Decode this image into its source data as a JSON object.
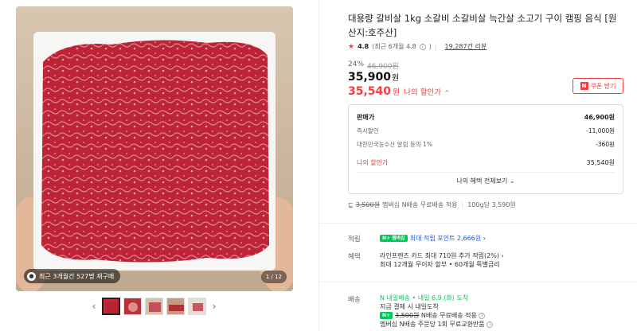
{
  "product": {
    "title": "대용량 갈비살 1kg 소갈비 소갈비살 늑간살 소고기 구이 캠핑 음식 [원산지:호주산]",
    "rating": "4.8",
    "rating_detail": "(최근 6개월 4.8",
    "reviews": "19,287건 리뷰",
    "discount_pct": "24%",
    "original_price": "46,900원",
    "price": "35,900",
    "price_unit": "원",
    "my_price": "35,540",
    "my_price_unit": "원",
    "my_price_label": "나의 할인가",
    "coupon_label": "쿠폰 받기"
  },
  "gallery": {
    "review_badge": "최근 3개월간 527명 재구매",
    "counter": "1 / 12"
  },
  "price_box": {
    "sale_label": "판매가",
    "sale_value": "46,900원",
    "instant_label": "즉시할인",
    "instant_value": "-11,000원",
    "agri_label": "대한민국농수산 알림 등의 1%",
    "agri_value": "-360원",
    "my_label": "나의 할인가",
    "my_value": "35,540원",
    "more_label": "나의 혜택 전체보기"
  },
  "shipping_line": {
    "strike": "3,500원",
    "text": "멤버십 N배송 무료배송 적용",
    "unit_price": "100g당 3,590원"
  },
  "points": {
    "label": "적립",
    "badge": "N+ 멤버십",
    "text": "최대 적립 포인트 2,666원"
  },
  "benefits": {
    "label": "혜택",
    "line1": "라인프렌즈 카드 최대 710원 추가 적립(2%)",
    "line2": "최대 12개월 무이자 할부 • 60개월 특별금리"
  },
  "delivery": {
    "label": "배송",
    "badge": "N 내일배송",
    "arrival": "내일 6.9.(화) 도착",
    "line2": "지금 결제 시 내일도착",
    "strike": "3,500원",
    "line3": "N배송 무료배송 적용",
    "line4": "멤버십 N배송 주문당 1회 무료교환반품"
  },
  "colors": {
    "accent": "#f53d3d",
    "npay": "#03c75a",
    "link": "#1b5bd9"
  }
}
